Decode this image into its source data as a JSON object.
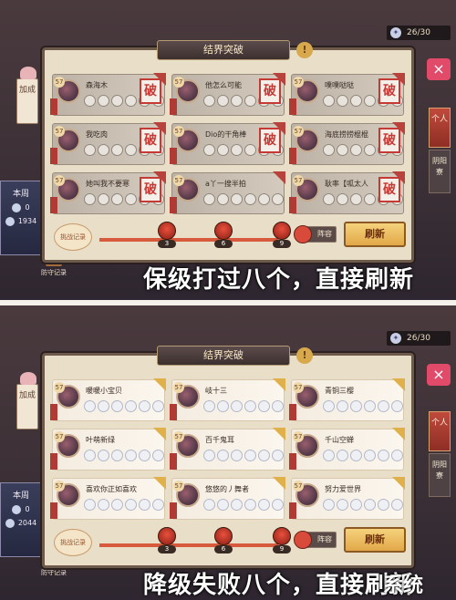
{
  "screens": [
    {
      "counter": "26/30",
      "title": "结界突破",
      "left_tab": "加成",
      "week": {
        "label": "本周",
        "count": "0",
        "score": "1934"
      },
      "record_label": "防守记录",
      "right_tab": {
        "personal": "个人",
        "guild": "阴阳寮"
      },
      "cards": [
        {
          "level": "57",
          "name": "森海木",
          "stamp": "破"
        },
        {
          "level": "57",
          "name": "他怎么可能",
          "stamp": "破"
        },
        {
          "level": "57",
          "name": "噗噗哒哒",
          "stamp": "破"
        },
        {
          "level": "57",
          "name": "我吃肉",
          "stamp": "破"
        },
        {
          "level": "57",
          "name": "Dio的干角棒",
          "stamp": "破"
        },
        {
          "level": "57",
          "name": "海底捞捞棍棍",
          "stamp": "破"
        },
        {
          "level": "57",
          "name": "她叫我不要寒",
          "stamp": "破"
        },
        {
          "level": "57",
          "name": "a丫一搜半拍",
          "stamp": ""
        },
        {
          "level": "57",
          "name": "耿率【呱太人",
          "stamp": "破"
        }
      ],
      "badge": "挑战记录",
      "milestones": [
        "3",
        "6",
        "9"
      ],
      "progress": 1.0,
      "lineup_label": "阵容",
      "refresh_label": "刷新",
      "caption": "保级打过八个，直接刷新"
    },
    {
      "counter": "26/30",
      "title": "结界突破",
      "left_tab": "加成",
      "week": {
        "label": "本周",
        "count": "0",
        "score": "2044"
      },
      "record_label": "防守记录",
      "right_tab": {
        "personal": "个人",
        "guild": "阴阳寮"
      },
      "cards": [
        {
          "level": "57",
          "name": "暖暖小宝贝",
          "stamp": ""
        },
        {
          "level": "57",
          "name": "岐十三",
          "stamp": ""
        },
        {
          "level": "57",
          "name": "青铜三樱",
          "stamp": ""
        },
        {
          "level": "57",
          "name": "叶萌新绿",
          "stamp": ""
        },
        {
          "level": "57",
          "name": "百千鬼耳",
          "stamp": ""
        },
        {
          "level": "57",
          "name": "千山空蝉",
          "stamp": ""
        },
        {
          "level": "57",
          "name": "喜欢你正如喜欢",
          "stamp": ""
        },
        {
          "level": "57",
          "name": "悠悠的丿舞者",
          "stamp": ""
        },
        {
          "level": "57",
          "name": "努力爱世界",
          "stamp": ""
        }
      ],
      "badge": "挑战记录",
      "milestones": [
        "3",
        "6",
        "9"
      ],
      "progress": 1.0,
      "lineup_label": "阵容",
      "refresh_label": "刷新",
      "caption": "降级失败八个，直接刷新"
    }
  ],
  "watermark": "系统"
}
